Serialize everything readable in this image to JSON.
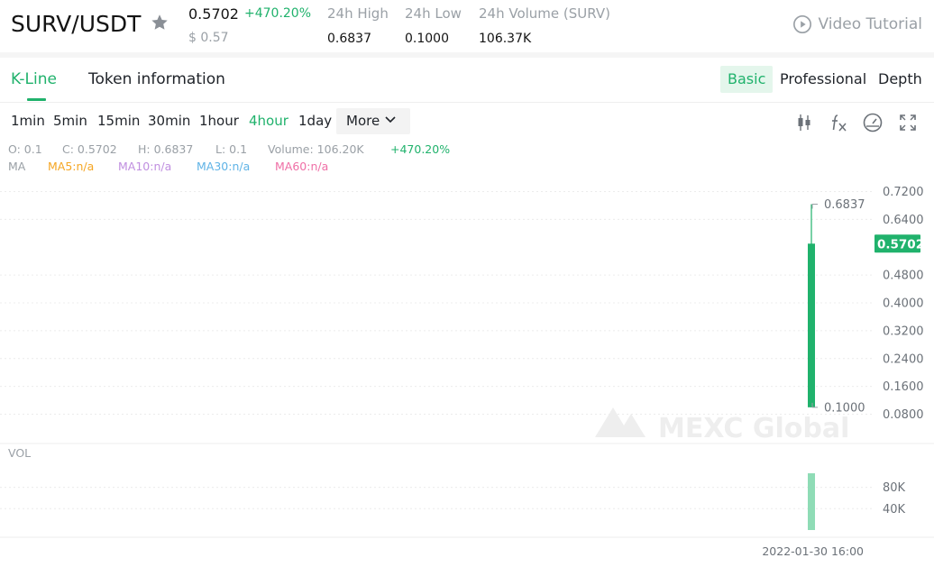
{
  "header": {
    "pair": "SURV/USDT",
    "price": "0.5702",
    "change": "+470.20%",
    "usd_price": "$ 0.57",
    "stats": [
      {
        "label": "24h High",
        "value": "0.6837"
      },
      {
        "label": "24h Low",
        "value": "0.1000"
      },
      {
        "label": "24h Volume (SURV)",
        "value": "106.37K"
      }
    ],
    "video_tutorial": "Video Tutorial"
  },
  "tabs": {
    "kline": "K-Line",
    "token_info": "Token information"
  },
  "views": [
    "Basic",
    "Professional",
    "Depth"
  ],
  "intervals": {
    "items": [
      "1min",
      "5min",
      "15min",
      "30min",
      "1hour",
      "4hour",
      "1day"
    ],
    "active": "4hour",
    "more": "More"
  },
  "toolbar_icons": [
    "candlestick-icon",
    "function-icon",
    "speedometer-icon",
    "fullscreen-icon"
  ],
  "ohlc": {
    "open": "O: 0.1",
    "close": "C: 0.5702",
    "high": "H: 0.6837",
    "low": "L: 0.1",
    "volume": "Volume: 106.20K",
    "change": "+470.20%"
  },
  "ma": {
    "label": "MA",
    "items": [
      {
        "text": "MA5:n/a",
        "color": "#f5a623"
      },
      {
        "text": "MA10:n/a",
        "color": "#c08fe0"
      },
      {
        "text": "MA30:n/a",
        "color": "#5fb3e6"
      },
      {
        "text": "MA60:n/a",
        "color": "#ef6fa6"
      }
    ]
  },
  "vol_label": "VOL",
  "watermark": "MEXC Global",
  "colors": {
    "accent": "#20b26c",
    "volume_bar": "#8fdcb6",
    "muted": "#9aa0a6"
  },
  "chart_data": {
    "type": "candlestick",
    "price_axis_ticks": [
      "0.7200",
      "0.6400",
      "0.4800",
      "0.4000",
      "0.3200",
      "0.2400",
      "0.1600",
      "0.0800"
    ],
    "volume_axis_ticks": [
      "80K",
      "40K"
    ],
    "ylim": [
      0.04,
      0.76
    ],
    "volume_ylim": [
      0,
      140000
    ],
    "candles": [
      {
        "time": "2022-01-30 16:00",
        "open": 0.1,
        "high": 0.6837,
        "low": 0.1,
        "close": 0.5702,
        "volume": 106200
      }
    ],
    "last_price_label": "0.5702",
    "high_marker": "0.6837",
    "low_marker": "0.1000",
    "x_label": "2022-01-30 16:00"
  }
}
